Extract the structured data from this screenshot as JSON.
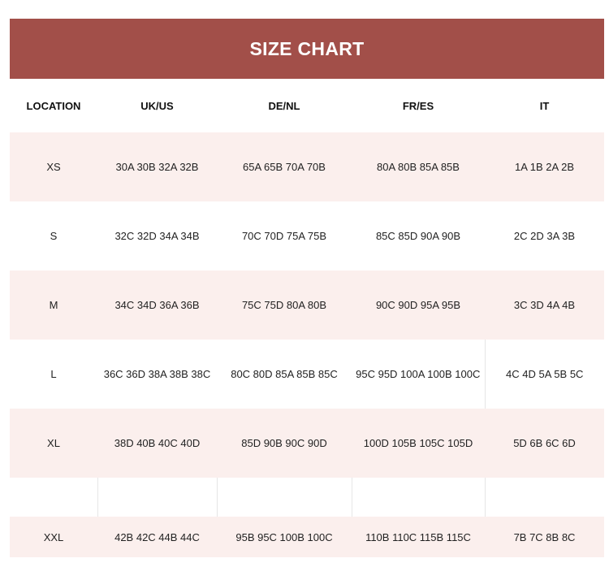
{
  "title": "SIZE CHART",
  "headers": [
    "LOCATION",
    "UK/US",
    "DE/NL",
    "FR/ES",
    "IT"
  ],
  "rows": [
    [
      "XS",
      "30A 30B 32A 32B",
      "65A 65B 70A 70B",
      "80A 80B 85A 85B",
      "1A 1B 2A 2B"
    ],
    [
      "S",
      "32C 32D 34A 34B",
      "70C 70D 75A 75B",
      "85C 85D 90A 90B",
      "2C 2D 3A 3B"
    ],
    [
      "M",
      "34C 34D 36A 36B",
      "75C 75D 80A 80B",
      "90C 90D 95A 95B",
      "3C 3D 4A 4B"
    ],
    [
      "L",
      "36C 36D 38A 38B 38C",
      "80C 80D 85A 85B 85C",
      "95C 95D 100A 100B 100C",
      "4C 4D 5A 5B 5C"
    ],
    [
      "XL",
      "38D 40B 40C 40D",
      "85D 90B 90C 90D",
      "100D 105B 105C 105D",
      "5D 6B 6C 6D"
    ],
    [
      "XXL",
      "42B 42C 44B 44C",
      "95B 95C 100B 100C",
      "110B 110C 115B 115C",
      "7B 7C 8B 8C"
    ]
  ],
  "colors": {
    "title_bar": "#a24f49",
    "row_tint": "#fbefed"
  }
}
